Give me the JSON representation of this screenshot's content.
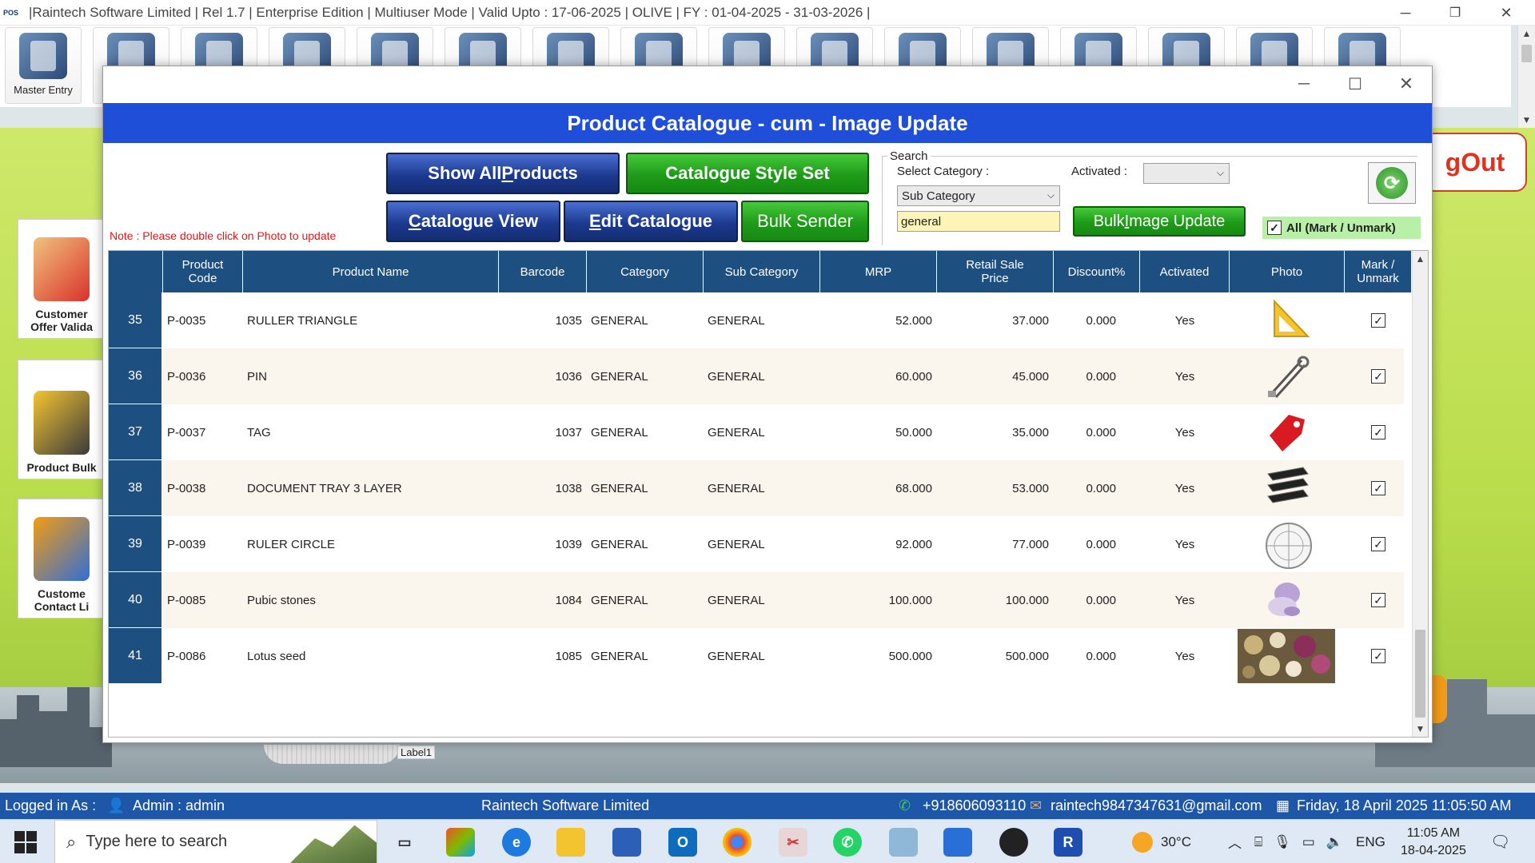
{
  "app": {
    "pos_logo": "POS",
    "title": "|Raintech Software Limited |  Rel 1.7  |  Enterprise Edition  |  Multiuser Mode  |  Valid Upto : 17-06-2025  |  OLIVE  |  FY : 01-04-2025  -  31-03-2026  |",
    "minimize": "─",
    "restore": "❐",
    "close": "✕"
  },
  "toolbar": {
    "master_entry_label": "Master Entry",
    "icons": [
      "master-entry-icon",
      "settings-wrench-icon",
      "gear-icon",
      "users-icon",
      "warehouse-icon",
      "house-icon",
      "report-icon",
      "document-icon",
      "chart-icon",
      "analytics-icon",
      "database-icon",
      "excel-export-icon",
      "network-icon",
      "settings-icon",
      "sync-icon",
      "user-id-icon"
    ]
  },
  "background": {
    "logout_label": "gOut",
    "side_cards": [
      {
        "label": "Customer\nOffer Valida",
        "icon": "gift-hand-icon"
      },
      {
        "label": "Product Bulk",
        "icon": "pencil-list-icon"
      },
      {
        "label": "Custome\nContact Li",
        "icon": "contact-book-icon"
      }
    ],
    "label1": "Label1"
  },
  "window": {
    "minimize": "─",
    "maximize": "☐",
    "close": "✕",
    "header": "Product Catalogue - cum - Image Update",
    "buttons": {
      "show_all_pre": "Show All ",
      "show_all_u": "P",
      "show_all_post": "roducts",
      "catalogue_style_set": "Catalogue Style Set",
      "catalogue_view_u": "C",
      "catalogue_view_post": "atalogue View",
      "edit_catalogue_u": "E",
      "edit_catalogue_post": "dit Catalogue",
      "bulk_sender": "Bulk Sender",
      "bulk_image_pre": "Bulk ",
      "bulk_image_u": "I",
      "bulk_image_post": "mage Update"
    },
    "note": "Note : Please double click on Photo to update",
    "search": {
      "legend": "Search",
      "select_category_label": "Select Category :",
      "category_value": "Sub Category",
      "activated_label": "Activated :",
      "activated_value": "",
      "text_value": "general"
    },
    "all_mark_label": "All (Mark / Unmark)",
    "columns": [
      "",
      "Product\nCode",
      "Product Name",
      "Barcode",
      "Category",
      "Sub Category",
      "MRP",
      "Retail Sale\nPrice",
      "Discount%",
      "Activated",
      "Photo",
      "Mark /\nUnmark"
    ],
    "rows": [
      {
        "no": "35",
        "code": "P-0035",
        "name": "RULLER TRIANGLE",
        "barcode": "1035",
        "category": "GENERAL",
        "sub_category": "GENERAL",
        "mrp": "52.000",
        "rsp": "37.000",
        "discount": "0.000",
        "activated": "Yes",
        "photo": "triangle-ruler-photo",
        "marked": true
      },
      {
        "no": "36",
        "code": "P-0036",
        "name": "PIN",
        "barcode": "1036",
        "category": "GENERAL",
        "sub_category": "GENERAL",
        "mrp": "60.000",
        "rsp": "45.000",
        "discount": "0.000",
        "activated": "Yes",
        "photo": "safety-pin-photo",
        "marked": true
      },
      {
        "no": "37",
        "code": "P-0037",
        "name": "TAG",
        "barcode": "1037",
        "category": "GENERAL",
        "sub_category": "GENERAL",
        "mrp": "50.000",
        "rsp": "35.000",
        "discount": "0.000",
        "activated": "Yes",
        "photo": "red-tag-photo",
        "marked": true
      },
      {
        "no": "38",
        "code": "P-0038",
        "name": "DOCUMENT TRAY 3 LAYER",
        "barcode": "1038",
        "category": "GENERAL",
        "sub_category": "GENERAL",
        "mrp": "68.000",
        "rsp": "53.000",
        "discount": "0.000",
        "activated": "Yes",
        "photo": "document-tray-photo",
        "marked": true
      },
      {
        "no": "39",
        "code": "P-0039",
        "name": "RULER CIRCLE",
        "barcode": "1039",
        "category": "GENERAL",
        "sub_category": "GENERAL",
        "mrp": "92.000",
        "rsp": "77.000",
        "discount": "0.000",
        "activated": "Yes",
        "photo": "circle-protractor-photo",
        "marked": true
      },
      {
        "no": "40",
        "code": "P-0085",
        "name": "Pubic stones",
        "barcode": "1084",
        "category": "GENERAL",
        "sub_category": "GENERAL",
        "mrp": "100.000",
        "rsp": "100.000",
        "discount": "0.000",
        "activated": "Yes",
        "photo": "pebble-stones-photo",
        "marked": true
      },
      {
        "no": "41",
        "code": "P-0086",
        "name": "Lotus seed",
        "barcode": "1085",
        "category": "GENERAL",
        "sub_category": "GENERAL",
        "mrp": "500.000",
        "rsp": "500.000",
        "discount": "0.000",
        "activated": "Yes",
        "photo": "lotus-seed-photo",
        "marked": true
      }
    ]
  },
  "statusbar": {
    "logged_in": "Logged in As :",
    "user": "Admin  :  admin",
    "company": "Raintech Software Limited",
    "phone": "+918606093110",
    "email": "raintech9847347631@gmail.com",
    "datetime": "Friday, 18 April 2025 11:05:50 AM"
  },
  "taskbar": {
    "search_placeholder": "Type here to search",
    "weather": "30°C",
    "lang": "ENG",
    "time": "11:05 AM",
    "date": "18-04-2025"
  },
  "colors": {
    "header_blue": "#1f4fd8",
    "grid_header": "#1d4f80",
    "status_blue": "#1e56a8",
    "note_red": "#e11111",
    "green_button": "#1e9a19"
  }
}
